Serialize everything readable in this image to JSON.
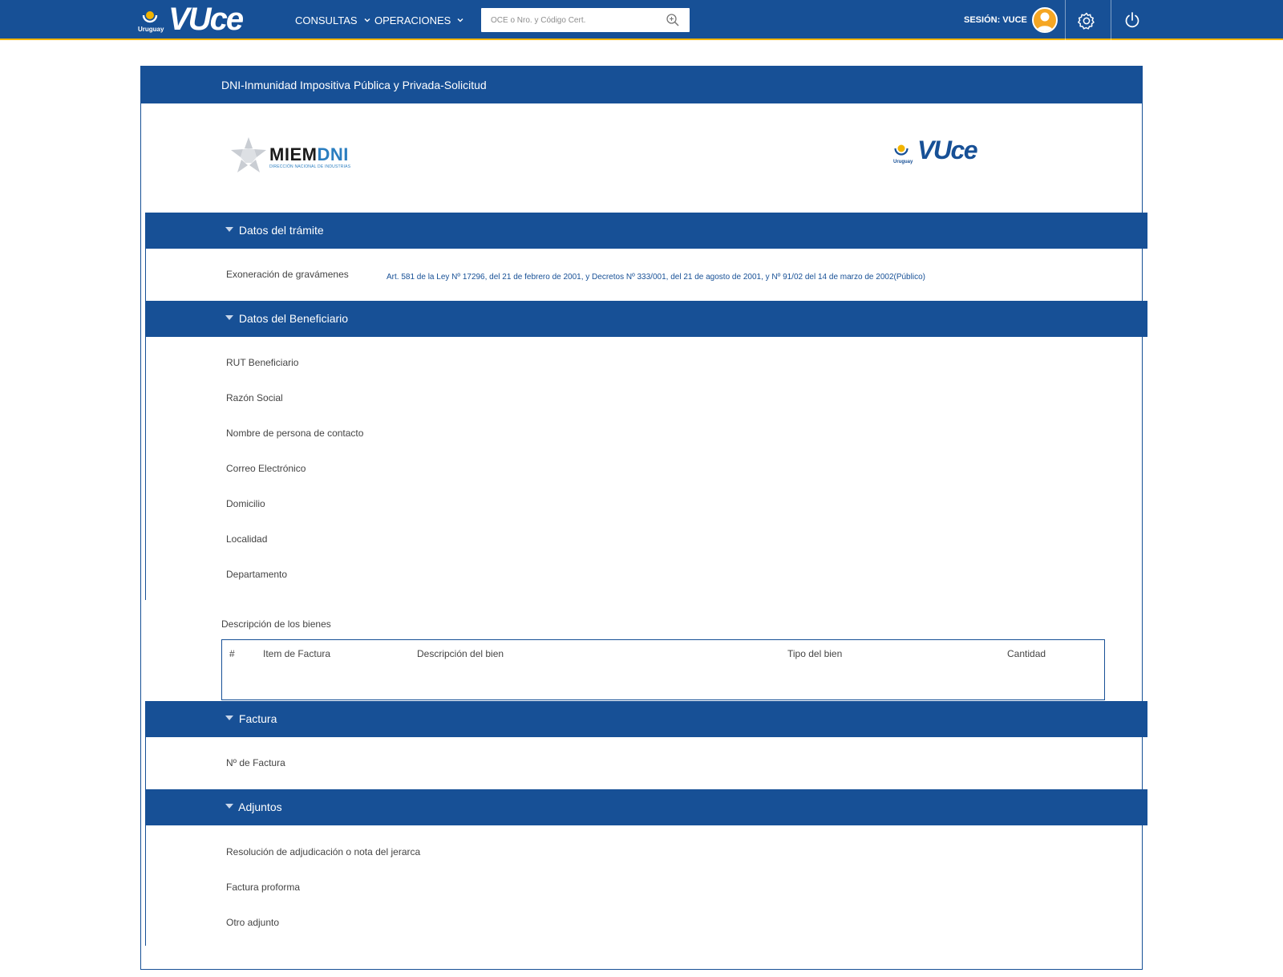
{
  "header": {
    "brand_country": "Uruguay",
    "brand_word": "VUce",
    "nav": [
      {
        "label": "CONSULTAS"
      },
      {
        "label": "OPERACIONES"
      }
    ],
    "search": {
      "placeholder": "OCE o Nro. y Código Cert.",
      "value": ""
    },
    "session_label": "SESIÓN: VUCE"
  },
  "panel": {
    "title": "DNI-Inmunidad Impositiva Pública y Privada-Solicitud",
    "logos": {
      "miem_name_a": "MIEM",
      "miem_name_b": "DNI",
      "miem_sub": "DIRECCIÓN NACIONAL DE INDUSTRIAS",
      "vuce_country": "Uruguay",
      "vuce_word": "VUce"
    }
  },
  "sections": {
    "tramite": {
      "title": "Datos del trámite",
      "fields": [
        {
          "label": "Exoneración de gravámenes",
          "value": "Art. 581 de la Ley Nº 17296, del 21 de febrero de 2001, y Decretos Nº 333/001, del 21 de agosto de 2001, y Nº 91/02 del 14 de marzo de 2002(Público)"
        }
      ]
    },
    "beneficiario": {
      "title": "Datos del Beneficiario",
      "fields": [
        {
          "label": "RUT Beneficiario"
        },
        {
          "label": "Razón Social"
        },
        {
          "label": "Nombre de persona de contacto"
        },
        {
          "label": "Correo Electrónico"
        },
        {
          "label": "Domicilio"
        },
        {
          "label": "Localidad"
        },
        {
          "label": "Departamento"
        }
      ]
    },
    "bienes": {
      "title": "Descripción de los bienes",
      "columns": [
        "#",
        "Item de Factura",
        "Descripción del bien",
        "Tipo del bien",
        "Cantidad"
      ]
    },
    "factura": {
      "title": "Factura",
      "fields": [
        {
          "label": "Nº de Factura"
        }
      ]
    },
    "adjuntos": {
      "title": "Adjuntos",
      "fields": [
        {
          "label": "Resolución de adjudicación o nota del jerarca"
        },
        {
          "label": "Factura proforma"
        },
        {
          "label": "Otro adjunto"
        }
      ]
    }
  },
  "colors": {
    "primary": "#175096",
    "accent": "#f2b400",
    "avatar": "#f5a623",
    "page_bg": "#ffffff"
  },
  "icons": [
    "uruguay-emblem-icon",
    "chevron-down-icon",
    "zoom-in-icon",
    "user-icon",
    "gear-icon",
    "power-icon",
    "miem-star-icon",
    "caret-down-icon"
  ]
}
